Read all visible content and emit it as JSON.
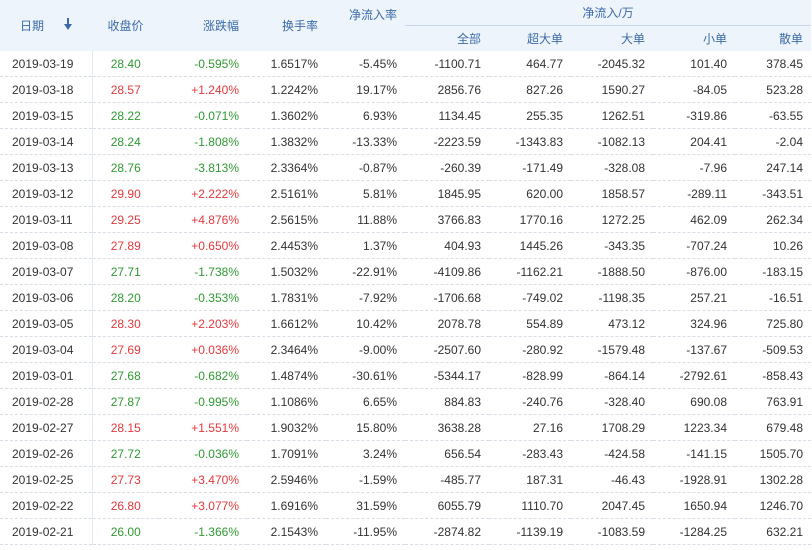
{
  "headers": {
    "date": "日期",
    "close": "收盘价",
    "change": "涨跌幅",
    "turnover": "换手率",
    "net_rate": "净流入率",
    "net_group": "净流入/万",
    "all": "全部",
    "super_large": "超大单",
    "large": "大单",
    "small": "小单",
    "retail": "散单"
  },
  "colors": {
    "up": "#e4393c",
    "down": "#2f9a32",
    "header_bg": "#eef4fb",
    "header_text": "#3c6ba8"
  },
  "icons": {
    "sort": "sort-down-arrow-icon"
  },
  "rows": [
    {
      "date": "2019-03-19",
      "close": "28.40",
      "change": "-0.595%",
      "dir": "down",
      "turnover": "1.6517%",
      "rate": "-5.45%",
      "all": "-1100.71",
      "super": "464.77",
      "large": "-2045.32",
      "small": "101.40",
      "retail": "378.45"
    },
    {
      "date": "2019-03-18",
      "close": "28.57",
      "change": "+1.240%",
      "dir": "up",
      "turnover": "1.2242%",
      "rate": "19.17%",
      "all": "2856.76",
      "super": "827.26",
      "large": "1590.27",
      "small": "-84.05",
      "retail": "523.28"
    },
    {
      "date": "2019-03-15",
      "close": "28.22",
      "change": "-0.071%",
      "dir": "down",
      "turnover": "1.3602%",
      "rate": "6.93%",
      "all": "1134.45",
      "super": "255.35",
      "large": "1262.51",
      "small": "-319.86",
      "retail": "-63.55"
    },
    {
      "date": "2019-03-14",
      "close": "28.24",
      "change": "-1.808%",
      "dir": "down",
      "turnover": "1.3832%",
      "rate": "-13.33%",
      "all": "-2223.59",
      "super": "-1343.83",
      "large": "-1082.13",
      "small": "204.41",
      "retail": "-2.04"
    },
    {
      "date": "2019-03-13",
      "close": "28.76",
      "change": "-3.813%",
      "dir": "down",
      "turnover": "2.3364%",
      "rate": "-0.87%",
      "all": "-260.39",
      "super": "-171.49",
      "large": "-328.08",
      "small": "-7.96",
      "retail": "247.14"
    },
    {
      "date": "2019-03-12",
      "close": "29.90",
      "change": "+2.222%",
      "dir": "up",
      "turnover": "2.5161%",
      "rate": "5.81%",
      "all": "1845.95",
      "super": "620.00",
      "large": "1858.57",
      "small": "-289.11",
      "retail": "-343.51"
    },
    {
      "date": "2019-03-11",
      "close": "29.25",
      "change": "+4.876%",
      "dir": "up",
      "turnover": "2.5615%",
      "rate": "11.88%",
      "all": "3766.83",
      "super": "1770.16",
      "large": "1272.25",
      "small": "462.09",
      "retail": "262.34"
    },
    {
      "date": "2019-03-08",
      "close": "27.89",
      "change": "+0.650%",
      "dir": "up",
      "turnover": "2.4453%",
      "rate": "1.37%",
      "all": "404.93",
      "super": "1445.26",
      "large": "-343.35",
      "small": "-707.24",
      "retail": "10.26"
    },
    {
      "date": "2019-03-07",
      "close": "27.71",
      "change": "-1.738%",
      "dir": "down",
      "turnover": "1.5032%",
      "rate": "-22.91%",
      "all": "-4109.86",
      "super": "-1162.21",
      "large": "-1888.50",
      "small": "-876.00",
      "retail": "-183.15"
    },
    {
      "date": "2019-03-06",
      "close": "28.20",
      "change": "-0.353%",
      "dir": "down",
      "turnover": "1.7831%",
      "rate": "-7.92%",
      "all": "-1706.68",
      "super": "-749.02",
      "large": "-1198.35",
      "small": "257.21",
      "retail": "-16.51"
    },
    {
      "date": "2019-03-05",
      "close": "28.30",
      "change": "+2.203%",
      "dir": "up",
      "turnover": "1.6612%",
      "rate": "10.42%",
      "all": "2078.78",
      "super": "554.89",
      "large": "473.12",
      "small": "324.96",
      "retail": "725.80"
    },
    {
      "date": "2019-03-04",
      "close": "27.69",
      "change": "+0.036%",
      "dir": "up",
      "turnover": "2.3464%",
      "rate": "-9.00%",
      "all": "-2507.60",
      "super": "-280.92",
      "large": "-1579.48",
      "small": "-137.67",
      "retail": "-509.53"
    },
    {
      "date": "2019-03-01",
      "close": "27.68",
      "change": "-0.682%",
      "dir": "down",
      "turnover": "1.4874%",
      "rate": "-30.61%",
      "all": "-5344.17",
      "super": "-828.99",
      "large": "-864.14",
      "small": "-2792.61",
      "retail": "-858.43"
    },
    {
      "date": "2019-02-28",
      "close": "27.87",
      "change": "-0.995%",
      "dir": "down",
      "turnover": "1.1086%",
      "rate": "6.65%",
      "all": "884.83",
      "super": "-240.76",
      "large": "-328.40",
      "small": "690.08",
      "retail": "763.91"
    },
    {
      "date": "2019-02-27",
      "close": "28.15",
      "change": "+1.551%",
      "dir": "up",
      "turnover": "1.9032%",
      "rate": "15.80%",
      "all": "3638.28",
      "super": "27.16",
      "large": "1708.29",
      "small": "1223.34",
      "retail": "679.48"
    },
    {
      "date": "2019-02-26",
      "close": "27.72",
      "change": "-0.036%",
      "dir": "down",
      "turnover": "1.7091%",
      "rate": "3.24%",
      "all": "656.54",
      "super": "-283.43",
      "large": "-424.58",
      "small": "-141.15",
      "retail": "1505.70"
    },
    {
      "date": "2019-02-25",
      "close": "27.73",
      "change": "+3.470%",
      "dir": "up",
      "turnover": "2.5946%",
      "rate": "-1.59%",
      "all": "-485.77",
      "super": "187.31",
      "large": "-46.43",
      "small": "-1928.91",
      "retail": "1302.28"
    },
    {
      "date": "2019-02-22",
      "close": "26.80",
      "change": "+3.077%",
      "dir": "up",
      "turnover": "1.6916%",
      "rate": "31.59%",
      "all": "6055.79",
      "super": "1110.70",
      "large": "2047.45",
      "small": "1650.94",
      "retail": "1246.70"
    },
    {
      "date": "2019-02-21",
      "close": "26.00",
      "change": "-1.366%",
      "dir": "down",
      "turnover": "2.1543%",
      "rate": "-11.95%",
      "all": "-2874.82",
      "super": "-1139.19",
      "large": "-1083.59",
      "small": "-1284.25",
      "retail": "632.21"
    }
  ]
}
